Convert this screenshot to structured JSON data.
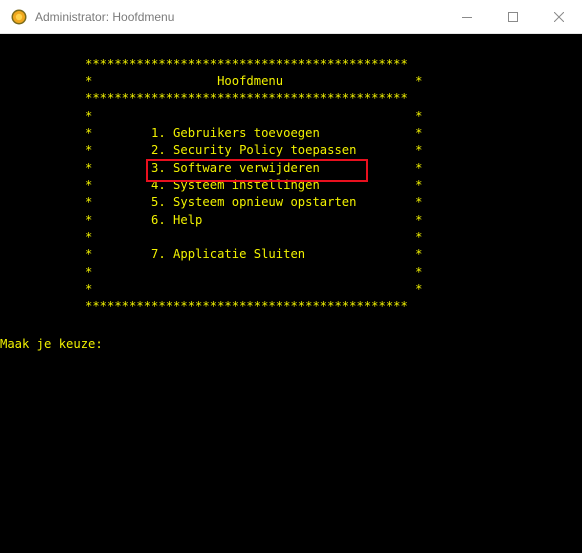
{
  "window": {
    "title": "Administrator: Hoofdmenu",
    "icon": "console-app-icon",
    "controls": [
      "minimize-icon",
      "maximize-icon",
      "close-icon"
    ]
  },
  "colors": {
    "console_bg": "#000000",
    "console_text": "#f2f200",
    "highlight_border": "#e8101e"
  },
  "console": {
    "border_line": "********************************************",
    "title_line": "*                 Hoofdmenu                  *",
    "empty_line": "*                                            *",
    "menu_items": [
      "*        1. Gebruikers toevoegen             *",
      "*        2. Security Policy toepassen        *",
      "*        3. Software verwijderen             *",
      "*        4. Systeem instellingen             *",
      "*        5. Systeem opnieuw opstarten        *",
      "*        6. Help                             *"
    ],
    "exit_item": "*        7. Applicatie Sluiten               *",
    "prompt": "Maak je keuze:"
  },
  "highlight": {
    "target": "menu_item_3"
  }
}
